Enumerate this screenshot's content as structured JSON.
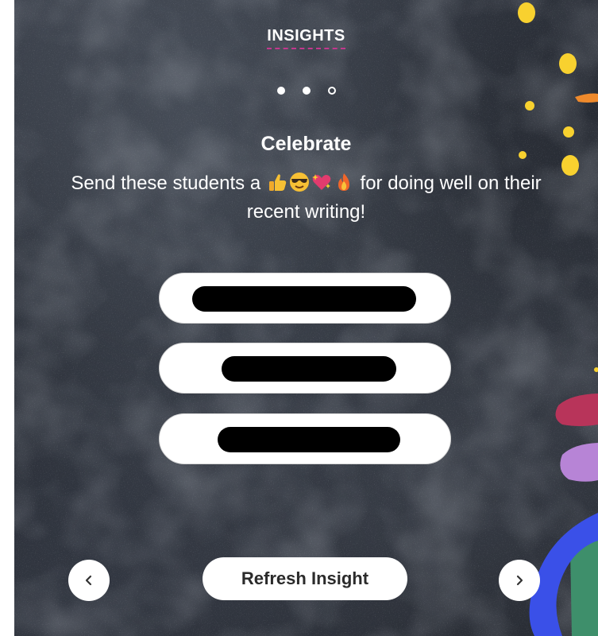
{
  "header": {
    "title": "INSIGHTS"
  },
  "pagination": {
    "total_steps": 3,
    "current_step": 3
  },
  "insight": {
    "heading": "Celebrate",
    "message_before": "Send these students a ",
    "emojis": [
      "thumbs-up-emoji",
      "cool-face-emoji",
      "sparkling-heart-emoji",
      "fire-emoji"
    ],
    "message_after": " for doing well on their recent writing!"
  },
  "students": [
    {
      "name": "[redacted]"
    },
    {
      "name": "[redacted]"
    },
    {
      "name": "[redacted]"
    }
  ],
  "actions": {
    "refresh_label": "Refresh Insight",
    "prev_icon": "chevron-left-icon",
    "next_icon": "chevron-right-icon"
  },
  "colors": {
    "background": "#2a2e36",
    "accent_underline": "#c2388e",
    "decor_yellow": "#f8d12f",
    "decor_orange": "#ef8a2c",
    "decor_crimson": "#b8345a",
    "decor_lavender": "#b784d6",
    "decor_green": "#3e8f6b",
    "decor_blue": "#3a50e8"
  }
}
